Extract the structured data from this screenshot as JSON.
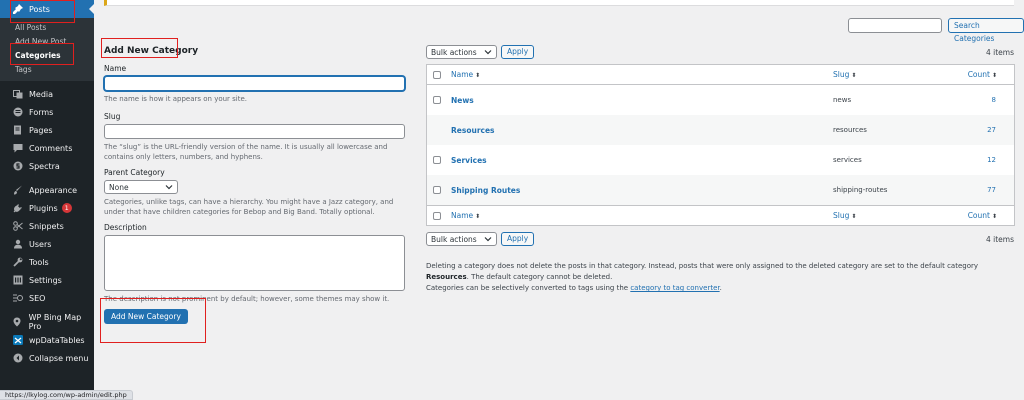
{
  "sidebar": {
    "posts_label": "Posts",
    "submenu": [
      "All Posts",
      "Add New Post",
      "Categories",
      "Tags"
    ],
    "items": [
      {
        "label": "Media",
        "icon": "media-icon"
      },
      {
        "label": "Forms",
        "icon": "forms-icon"
      },
      {
        "label": "Pages",
        "icon": "pages-icon"
      },
      {
        "label": "Comments",
        "icon": "comments-icon"
      },
      {
        "label": "Spectra",
        "icon": "spectra-icon"
      },
      {
        "label": "Appearance",
        "icon": "appearance-icon"
      },
      {
        "label": "Plugins",
        "icon": "plugins-icon",
        "badge": "1"
      },
      {
        "label": "Snippets",
        "icon": "snippets-icon"
      },
      {
        "label": "Users",
        "icon": "users-icon"
      },
      {
        "label": "Tools",
        "icon": "tools-icon"
      },
      {
        "label": "Settings",
        "icon": "settings-icon"
      },
      {
        "label": "SEO",
        "icon": "seo-icon"
      },
      {
        "label": "WP Bing Map Pro",
        "icon": "map-pin-icon"
      },
      {
        "label": "wpDataTables",
        "icon": "wpdatatables-icon"
      },
      {
        "label": "Collapse menu",
        "icon": "collapse-icon"
      }
    ]
  },
  "form": {
    "title": "Add New Category",
    "name_label": "Name",
    "name_help": "The name is how it appears on your site.",
    "slug_label": "Slug",
    "slug_help": "The “slug” is the URL-friendly version of the name. It is usually all lowercase and contains only letters, numbers, and hyphens.",
    "parent_label": "Parent Category",
    "parent_value": "None",
    "parent_help": "Categories, unlike tags, can have a hierarchy. You might have a Jazz category, and under that have children categories for Bebop and Big Band. Totally optional.",
    "description_label": "Description",
    "description_help": "The description is not prominent by default; however, some themes may show it.",
    "submit_label": "Add New Category"
  },
  "list": {
    "search_button": "Search Categories",
    "bulk_actions": "Bulk actions",
    "apply": "Apply",
    "items_count": "4 items",
    "col_name": "Name",
    "col_slug": "Slug",
    "col_count": "Count",
    "sort_glyph": "⬍",
    "rows": [
      {
        "name": "News",
        "slug": "news",
        "count": "8",
        "checkbox": true
      },
      {
        "name": "Resources",
        "slug": "resources",
        "count": "27",
        "checkbox": false
      },
      {
        "name": "Services",
        "slug": "services",
        "count": "12",
        "checkbox": true
      },
      {
        "name": "Shipping Routes",
        "slug": "shipping-routes",
        "count": "77",
        "checkbox": true
      }
    ],
    "note_1a": "Deleting a category does not delete the posts in that category. Instead, posts that were only assigned to the deleted category are set to the default category ",
    "note_1b": "Resources",
    "note_1c": ". The default category cannot be deleted.",
    "note_2a": "Categories can be selectively converted to tags using the ",
    "note_2b": "category to tag converter",
    "note_2c": "."
  },
  "statusbar": "https://lkylog.com/wp-admin/edit.php",
  "colors": {
    "accent": "#2271b1",
    "sidebar": "#1d2327",
    "highlight": "#e0201f"
  }
}
